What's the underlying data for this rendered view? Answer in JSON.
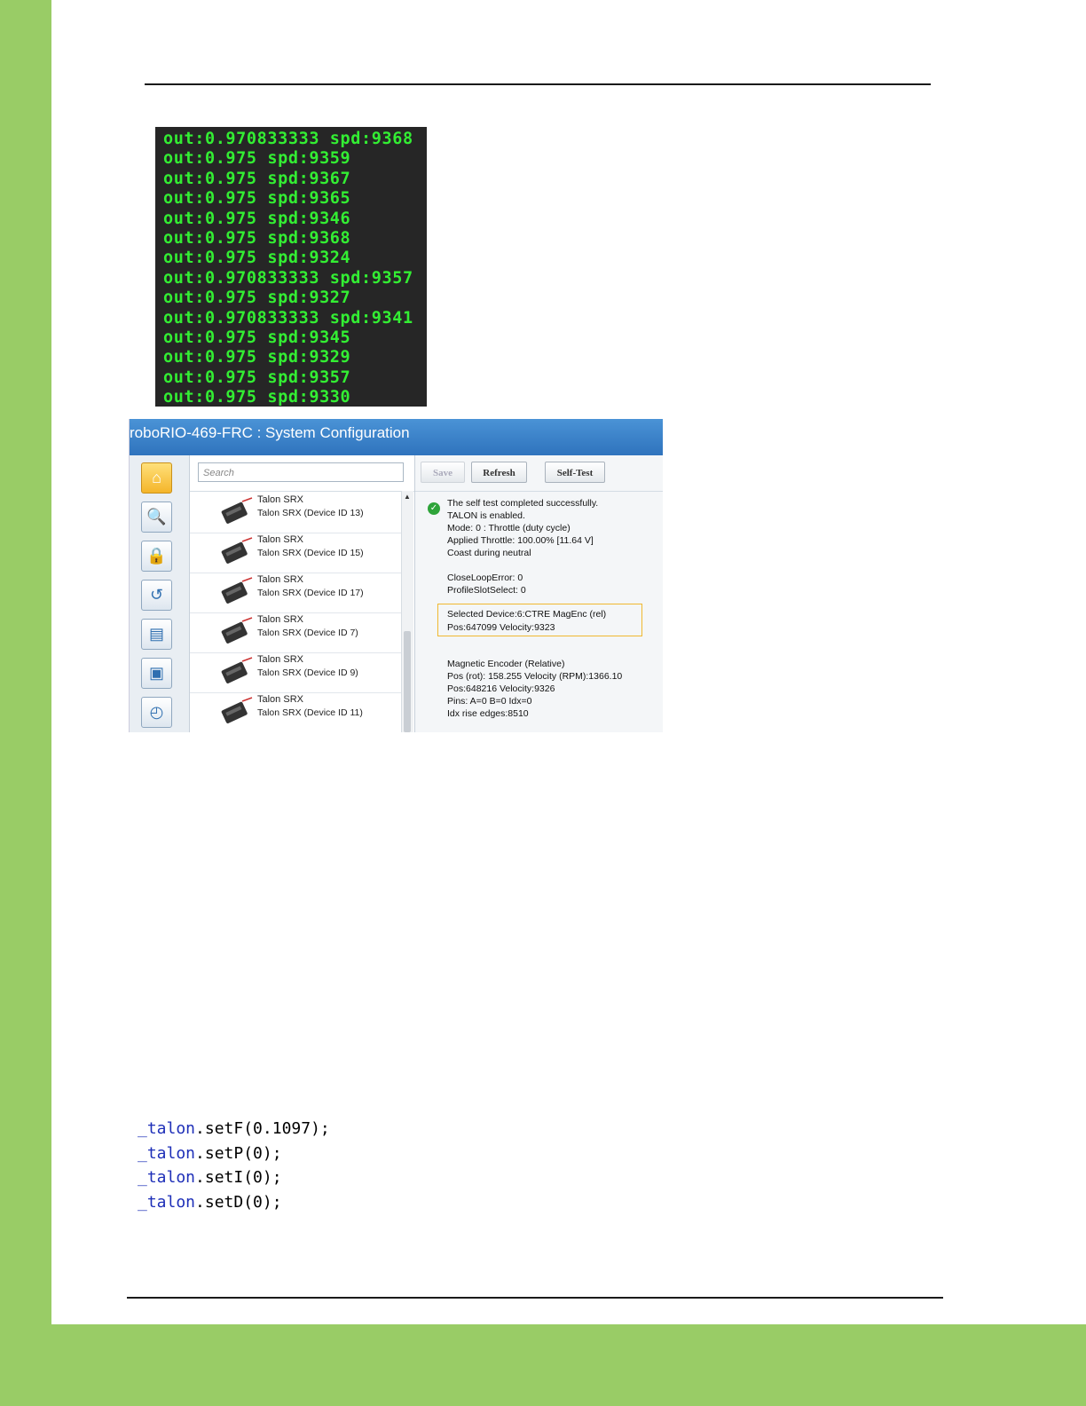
{
  "console": {
    "lines": [
      "out:0.970833333 spd:9368",
      "out:0.975 spd:9359",
      "out:0.975 spd:9367",
      "out:0.975 spd:9365",
      "out:0.975 spd:9346",
      "out:0.975 spd:9368",
      "out:0.975 spd:9324",
      "out:0.970833333 spd:9357",
      "out:0.975 spd:9327",
      "out:0.970833333 spd:9341",
      "out:0.975 spd:9345",
      "out:0.975 spd:9329",
      "out:0.975 spd:9357",
      "out:0.975 spd:9330"
    ]
  },
  "window": {
    "title": "roboRIO-469-FRC : System Configuration",
    "search_placeholder": "Search",
    "buttons": {
      "save": "Save",
      "refresh": "Refresh",
      "self_test": "Self-Test"
    },
    "devices": [
      {
        "name": "Talon SRX",
        "detail": "Talon SRX (Device ID 13)"
      },
      {
        "name": "Talon SRX",
        "detail": "Talon SRX (Device ID 15)"
      },
      {
        "name": "Talon SRX",
        "detail": "Talon SRX (Device ID 17)"
      },
      {
        "name": "Talon SRX",
        "detail": "Talon SRX (Device ID 7)"
      },
      {
        "name": "Talon SRX",
        "detail": "Talon SRX (Device ID 9)"
      },
      {
        "name": "Talon SRX",
        "detail": "Talon SRX (Device ID 11)"
      }
    ],
    "info": {
      "l1": "The self test completed successfully.",
      "l2": "TALON is enabled.",
      "l3": "Mode: 0 : Throttle (duty cycle)",
      "l4": "Applied Throttle:  100.00% [11.64 V]",
      "l5": "Coast during neutral",
      "l6": "CloseLoopError: 0",
      "l7": "ProfileSlotSelect: 0",
      "l8": "Selected Device:6:CTRE MagEnc (rel)",
      "l9": "Pos:647099   Velocity:9323",
      "l10": "Magnetic Encoder (Relative)",
      "l11": "Pos (rot): 158.255  Velocity (RPM):1366.10",
      "l12": "Pos:648216   Velocity:9326",
      "l13": "Pins: A=0 B=0 Idx=0",
      "l14": "Idx rise edges:8510"
    }
  },
  "code": {
    "object": "_talon",
    "lines": [
      {
        "call": ".setF(0.1097);"
      },
      {
        "call": ".setP(0);"
      },
      {
        "call": ".setI(0);"
      },
      {
        "call": ".setD(0);"
      }
    ]
  }
}
